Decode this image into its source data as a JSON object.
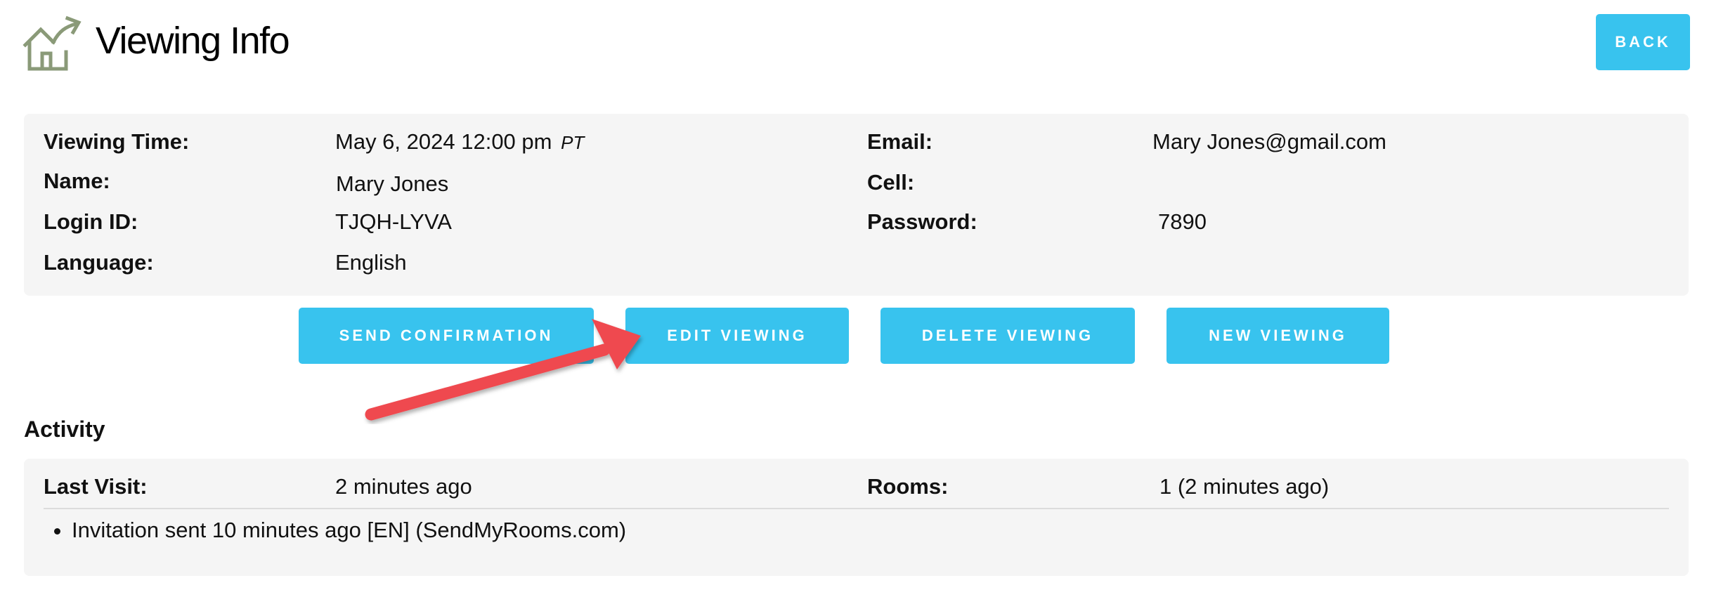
{
  "header": {
    "title": "Viewing Info",
    "logo_icon": "house-arrow-icon",
    "back_label": "BACK"
  },
  "viewing": {
    "time_label": "Viewing Time:",
    "time_value": "May 6, 2024 12:00 pm",
    "time_zone": "PT",
    "name_label": "Name:",
    "name_value": "Mary Jones",
    "login_label": "Login ID:",
    "login_value": "TJQH-LYVA",
    "language_label": "Language:",
    "language_value": "English",
    "email_label": "Email:",
    "email_value": "Mary Jones@gmail.com",
    "cell_label": "Cell:",
    "cell_value": "",
    "password_label": "Password:",
    "password_value": "7890"
  },
  "actions": {
    "send_confirmation": "SEND CONFIRMATION",
    "edit_viewing": "EDIT VIEWING",
    "delete_viewing": "DELETE VIEWING",
    "new_viewing": "NEW VIEWING"
  },
  "activity": {
    "heading": "Activity",
    "last_visit_label": "Last Visit:",
    "last_visit_value": "2 minutes ago",
    "rooms_label": "Rooms:",
    "rooms_value": "1 (2 minutes ago)",
    "events": [
      "Invitation sent 10 minutes ago [EN] (SendMyRooms.com)"
    ]
  },
  "colors": {
    "accent": "#38c3ee",
    "panel_bg": "#f5f5f5",
    "annotation_arrow": "#ef4a4f",
    "logo": "#8a9a78"
  }
}
